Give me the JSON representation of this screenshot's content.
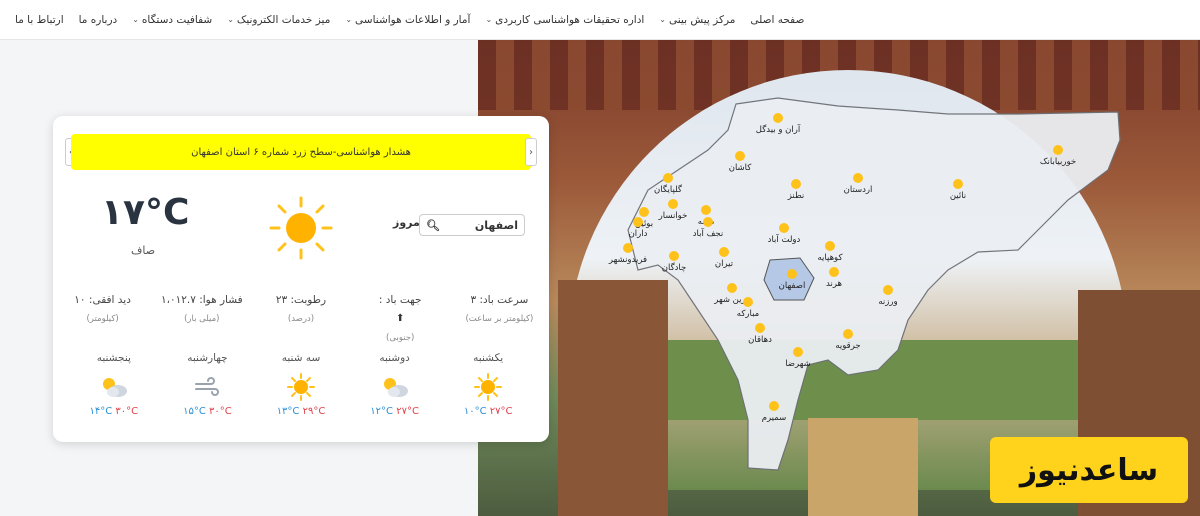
{
  "nav": {
    "items": [
      {
        "label": "صفحه اصلی",
        "dropdown": false
      },
      {
        "label": "مرکز پیش بینی",
        "dropdown": true
      },
      {
        "label": "اداره تحقیقات هواشناسی کاربردی",
        "dropdown": true
      },
      {
        "label": "آمار و اطلاعات هواشناسی",
        "dropdown": true
      },
      {
        "label": "میز خدمات الکترونیک",
        "dropdown": true
      },
      {
        "label": "شفافیت دستگاه",
        "dropdown": true
      },
      {
        "label": "درباره ما",
        "dropdown": false
      },
      {
        "label": "ارتباط با ما",
        "dropdown": false
      }
    ]
  },
  "alert": {
    "text": "هشدار هواشناسی-سطح زرد شماره ۶ استان اصفهان"
  },
  "current": {
    "temp": "۱۷°C",
    "condition": "صاف",
    "today_label": "امروز",
    "city": "اصفهان",
    "icon": "sun-icon"
  },
  "stats": [
    {
      "main": "سرعت باد: ۳",
      "sub": "(کیلومتر بر ساعت)"
    },
    {
      "main": "جهت باد :",
      "sub": "(جنوبی)",
      "icon": "wind-direction-icon"
    },
    {
      "main": "رطوبت: ۲۳",
      "sub": "(درصد)"
    },
    {
      "main": "فشار هوا: ۱،۰۱۲.۷",
      "sub": "(میلی بار)"
    },
    {
      "main": "دید افقی: ۱۰",
      "sub": "(کیلومتر)"
    }
  ],
  "forecast": [
    {
      "day": "یکشنبه",
      "icon": "sun-icon",
      "hi": "۲۷°C",
      "lo": "۱۰°C"
    },
    {
      "day": "دوشنبه",
      "icon": "partly-cloudy-icon",
      "hi": "۲۷°C",
      "lo": "۱۲°C"
    },
    {
      "day": "سه شنبه",
      "icon": "sun-icon",
      "hi": "۲۹°C",
      "lo": "۱۳°C"
    },
    {
      "day": "چهارشنبه",
      "icon": "wind-icon",
      "hi": "۳۰°C",
      "lo": "۱۵°C"
    },
    {
      "day": "پنجشنبه",
      "icon": "partly-cloudy-icon",
      "hi": "۳۰°C",
      "lo": "۱۴°C"
    }
  ],
  "map": {
    "cities": [
      "آران و بیدگل",
      "کاشان",
      "نطنز",
      "اردستان",
      "نائین",
      "خوربیابانک",
      "گلپایگان",
      "خوانسار",
      "میمه",
      "بوئین",
      "داران",
      "نجف آباد",
      "دولت آباد",
      "فریدونشهر",
      "چادگان",
      "تیران",
      "کوهپایه",
      "اصفهان",
      "هرند",
      "ورزنه",
      "زرین شهر",
      "مبارکه",
      "دهاقان",
      "جرقویه",
      "شهرضا",
      "سمیرم"
    ]
  },
  "brand": {
    "text": "ساعدنیوز"
  },
  "colors": {
    "alert": "#ffff00",
    "hi": "#e0404a",
    "lo": "#2c8fd6",
    "sun": "#ffc21a",
    "brand": "#ffd21c"
  }
}
